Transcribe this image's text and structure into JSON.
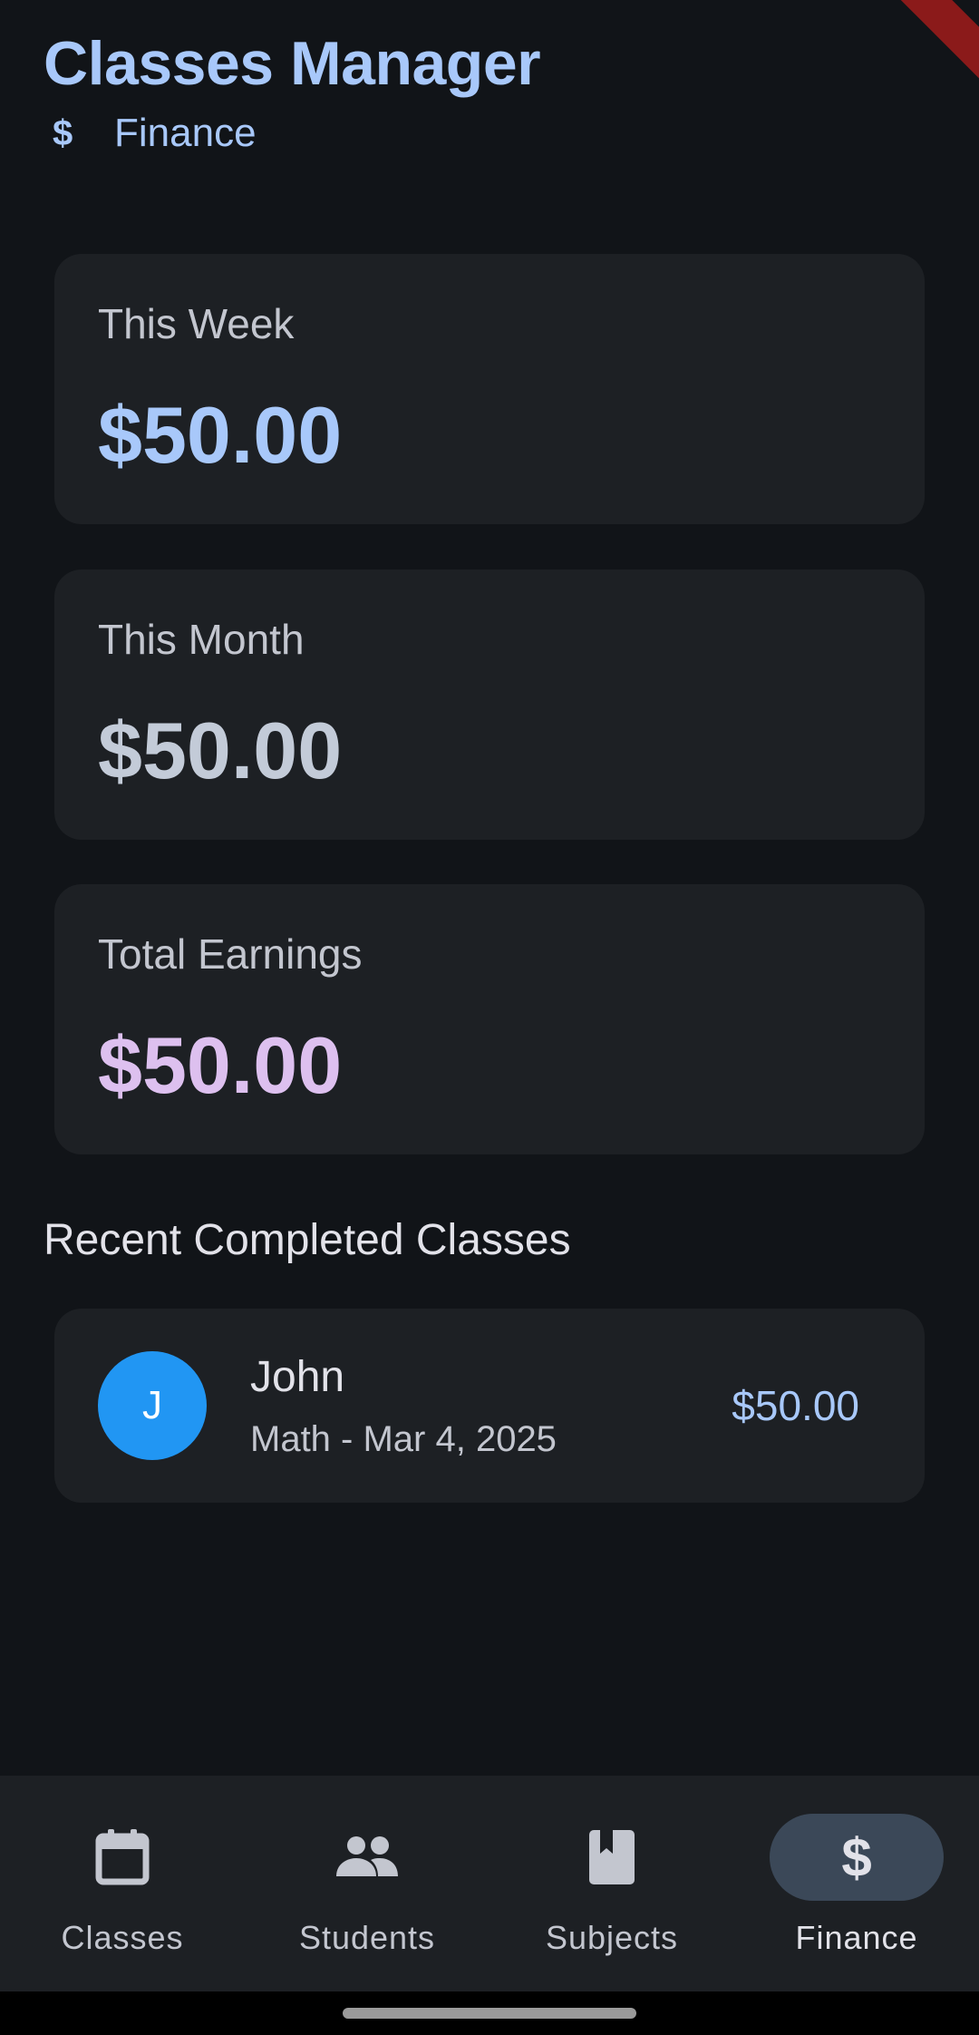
{
  "header": {
    "title": "Classes Manager",
    "section_icon": "dollar-icon",
    "section_label": "Finance"
  },
  "stats": [
    {
      "label": "This Week",
      "value": "$50.00",
      "color": "#a8c8fa"
    },
    {
      "label": "This Month",
      "value": "$50.00",
      "color": "#c3cbd8"
    },
    {
      "label": "Total Earnings",
      "value": "$50.00",
      "color": "#ddc0ef"
    }
  ],
  "recent": {
    "title": "Recent Completed Classes",
    "items": [
      {
        "avatar_initial": "J",
        "avatar_color": "#2196f3",
        "name": "John",
        "details": "Math - Mar 4, 2025",
        "amount": "$50.00"
      }
    ]
  },
  "nav": {
    "items": [
      {
        "label": "Classes",
        "icon": "calendar-icon",
        "active": false
      },
      {
        "label": "Students",
        "icon": "people-icon",
        "active": false
      },
      {
        "label": "Subjects",
        "icon": "book-icon",
        "active": false
      },
      {
        "label": "Finance",
        "icon": "dollar-icon",
        "active": true
      }
    ]
  },
  "dollar_glyph": "$"
}
